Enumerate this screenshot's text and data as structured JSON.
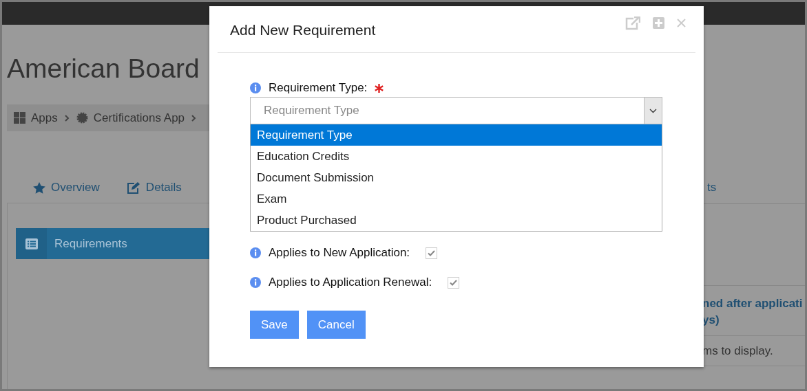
{
  "page": {
    "title": "American Board",
    "breadcrumb": [
      "Apps",
      "Certifications App"
    ],
    "tabs": [
      "Overview",
      "Details"
    ],
    "tab_fragment": "ts",
    "sidebar": [
      {
        "label": "Requirements",
        "selected": true
      }
    ],
    "table_header": [
      "ned after applicati",
      "ys)"
    ],
    "empty_message": "ms to display."
  },
  "dialog": {
    "title": "Add New Requirement",
    "field": {
      "label": "Requirement Type:",
      "required": true,
      "placeholder": "Requirement Type",
      "options": [
        {
          "label": "Requirement Type",
          "selected": true
        },
        {
          "label": "Education Credits",
          "selected": false
        },
        {
          "label": "Document Submission",
          "selected": false
        },
        {
          "label": "Exam",
          "selected": false
        },
        {
          "label": "Product Purchased",
          "selected": false
        }
      ]
    },
    "checkboxes": [
      {
        "label": "Applies to New Application:",
        "checked": true
      },
      {
        "label": "Applies to Application Renewal:",
        "checked": true
      }
    ],
    "buttons": [
      "Save",
      "Cancel"
    ]
  }
}
